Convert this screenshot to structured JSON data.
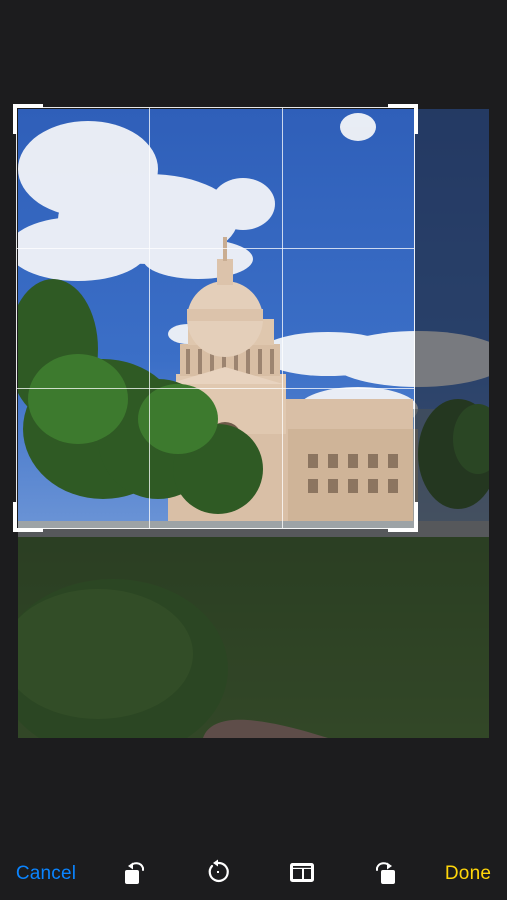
{
  "toolbar": {
    "cancel_label": "Cancel",
    "done_label": "Done",
    "icons": [
      "rotate-left-icon",
      "revert-rotation-icon",
      "aspect-ratio-icon",
      "rotate-right-icon"
    ]
  },
  "colors": {
    "background": "#1c1c1e",
    "cancel": "#0a84ff",
    "done": "#ffd60a",
    "crop_frame": "#ffffff"
  }
}
